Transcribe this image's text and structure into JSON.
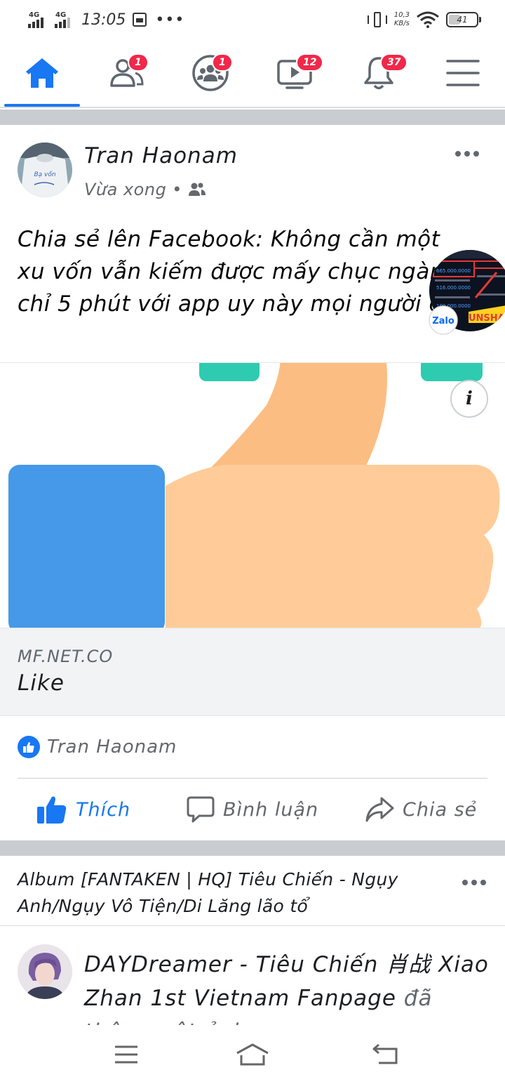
{
  "status_bar": {
    "net1": "4G",
    "net2": "4G",
    "time": "13:05",
    "overflow": "•••",
    "speed_value": "10,3",
    "speed_unit": "KB/s",
    "battery": "41"
  },
  "top_nav": {
    "tabs": [
      {
        "icon": "home-icon",
        "active": true
      },
      {
        "icon": "friends-icon",
        "badge": "1"
      },
      {
        "icon": "groups-icon",
        "badge": "1"
      },
      {
        "icon": "watch-icon",
        "badge": "12"
      },
      {
        "icon": "notifications-icon",
        "badge": "37"
      },
      {
        "icon": "menu-icon"
      }
    ]
  },
  "post1": {
    "author": "Tran Haonam",
    "time": "Vừa xong",
    "audience_icon": "friends-icon",
    "text": "Chia sẻ lên Facebook: Không cần một xu vốn vẫn kiếm được mấy chục ngàn chỉ 5 phút với app uy này mọi người ơi",
    "avatar_text": "Bạ vốn",
    "link": {
      "domain": "MF.NET.CO",
      "title": "Like",
      "info": "i"
    },
    "reactions": {
      "names": "Tran Haonam"
    },
    "actions": {
      "like": "Thích",
      "comment": "Bình luận",
      "share": "Chia sẻ"
    }
  },
  "chat_head": {
    "app": "Zalo",
    "overlay_text": "UNSHARE",
    "numbers": [
      "665.000.0000",
      "516.000.0000",
      "100.000.0000"
    ]
  },
  "post2": {
    "album_title": "Album [FANTAKEN | HQ] Tiêu Chiến - Ngụy Anh/Ngụy Vô Tiện/Di Lăng lão tổ",
    "page_name": "DAYDreamer - Tiêu Chiến 肖战 Xiao Zhan 1st Vietnam Fanpage",
    "action": "đã thêm một ảnh"
  },
  "colors": {
    "accent": "#1877f2",
    "badge": "#f02849",
    "separator": "#c9ccd1",
    "thumb_skin": "#ffcc99",
    "thumb_shadow": "#fbbd82",
    "cuff_blue": "#4599e8",
    "teal": "#2ecbb1"
  }
}
